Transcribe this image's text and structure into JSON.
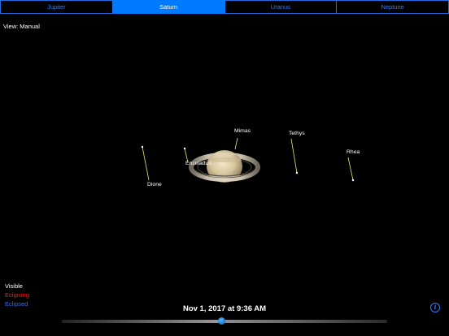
{
  "tabs": [
    {
      "label": "Jupiter",
      "selected": false
    },
    {
      "label": "Saturn",
      "selected": true
    },
    {
      "label": "Uranus",
      "selected": false
    },
    {
      "label": "Neptune",
      "selected": false
    }
  ],
  "view_label": "View: Manual",
  "moons": {
    "dione": "Dione",
    "enceladus": "Enceladus",
    "mimas": "Mimas",
    "tethys": "Tethys",
    "rhea": "Rhea"
  },
  "legend": {
    "visible": "Visible",
    "eclipsing": "Eclipsing",
    "eclipsed": "Eclipsed"
  },
  "colors": {
    "accent": "#007aff",
    "eclipsing": "#ff1a1a",
    "eclipsed": "#2f6bff",
    "orbit_line": "#e6e37a"
  },
  "date_text": "Nov 1, 2017 at 9:36 AM",
  "time_slider": {
    "progress": 0.49
  },
  "info_icon": "i"
}
